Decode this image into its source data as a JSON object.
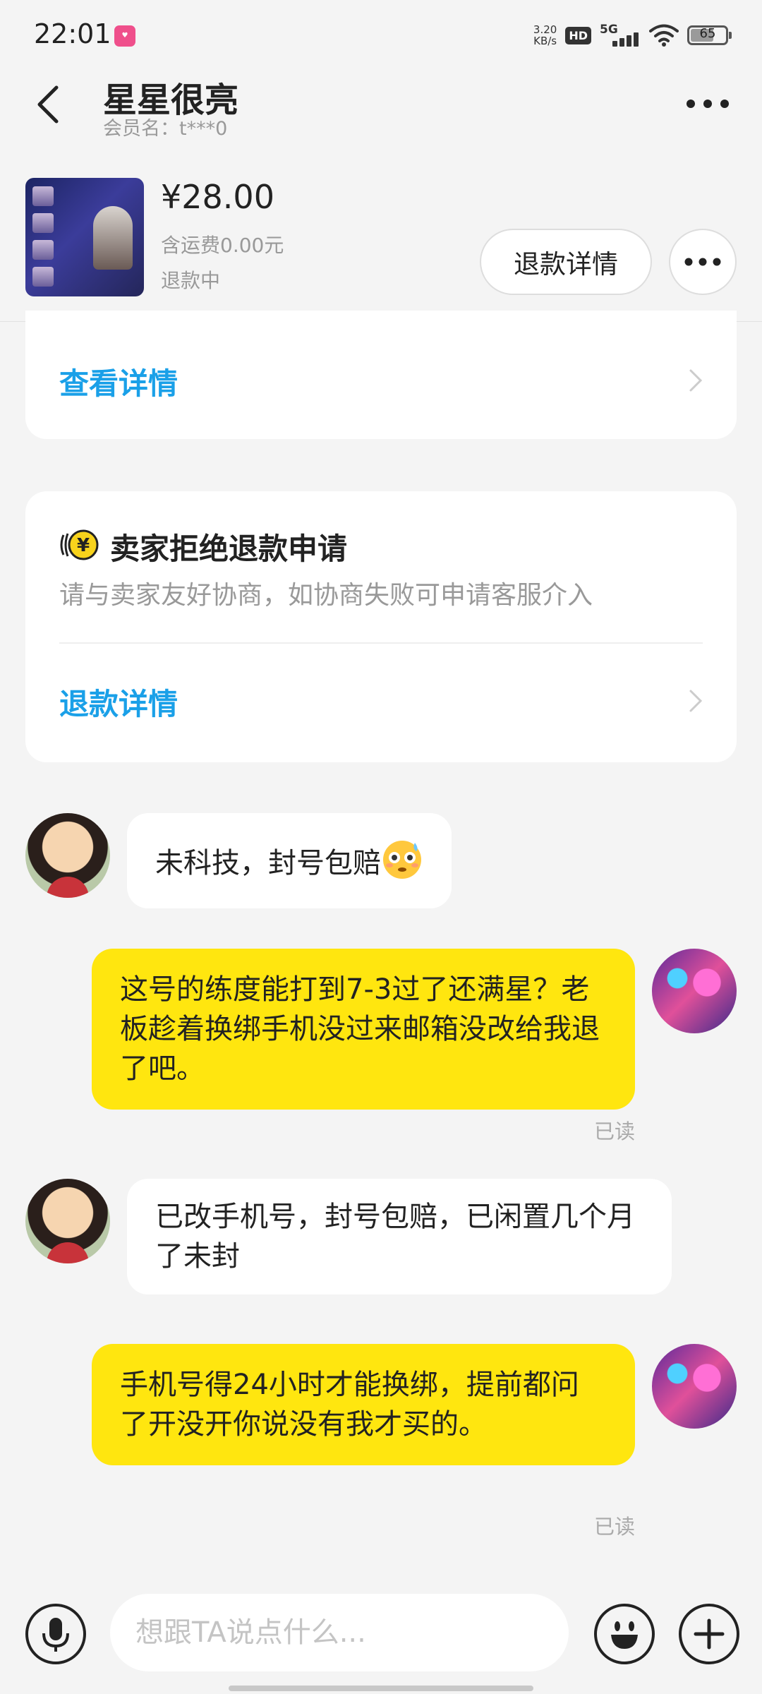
{
  "status_bar": {
    "time": "22:01",
    "net_speed_value": "3.20",
    "net_speed_unit": "KB/s",
    "hd_label": "HD",
    "network_label": "5G",
    "battery": "65"
  },
  "header": {
    "title": "星星很亮",
    "member_name": "会员名：t***0"
  },
  "product": {
    "price": "¥28.00",
    "shipping": "含运费0.00元",
    "status": "退款中",
    "refund_button": "退款详情"
  },
  "card_view_details": {
    "link": "查看详情"
  },
  "card_refund": {
    "title": "卖家拒绝退款申请",
    "description": "请与卖家友好协商，如协商失败可申请客服介入",
    "link": "退款详情"
  },
  "messages": [
    {
      "sender": "seller",
      "text": "未科技，封号包赔"
    },
    {
      "sender": "buyer",
      "text": "这号的练度能打到7-3过了还满星？老板趁着换绑手机没过来邮箱没改给我退了吧。",
      "status": "已读"
    },
    {
      "sender": "seller",
      "text": "已改手机号，封号包赔，已闲置几个月了未封"
    },
    {
      "sender": "buyer",
      "text": "手机号得24小时才能换绑，提前都问了开没开你说没有我才买的。",
      "status": "已读"
    }
  ],
  "input_bar": {
    "placeholder": "想跟TA说点什么..."
  },
  "colors": {
    "accent_link": "#1aa0e8",
    "outgoing_bubble": "#ffe60f",
    "background": "#f4f4f4"
  }
}
